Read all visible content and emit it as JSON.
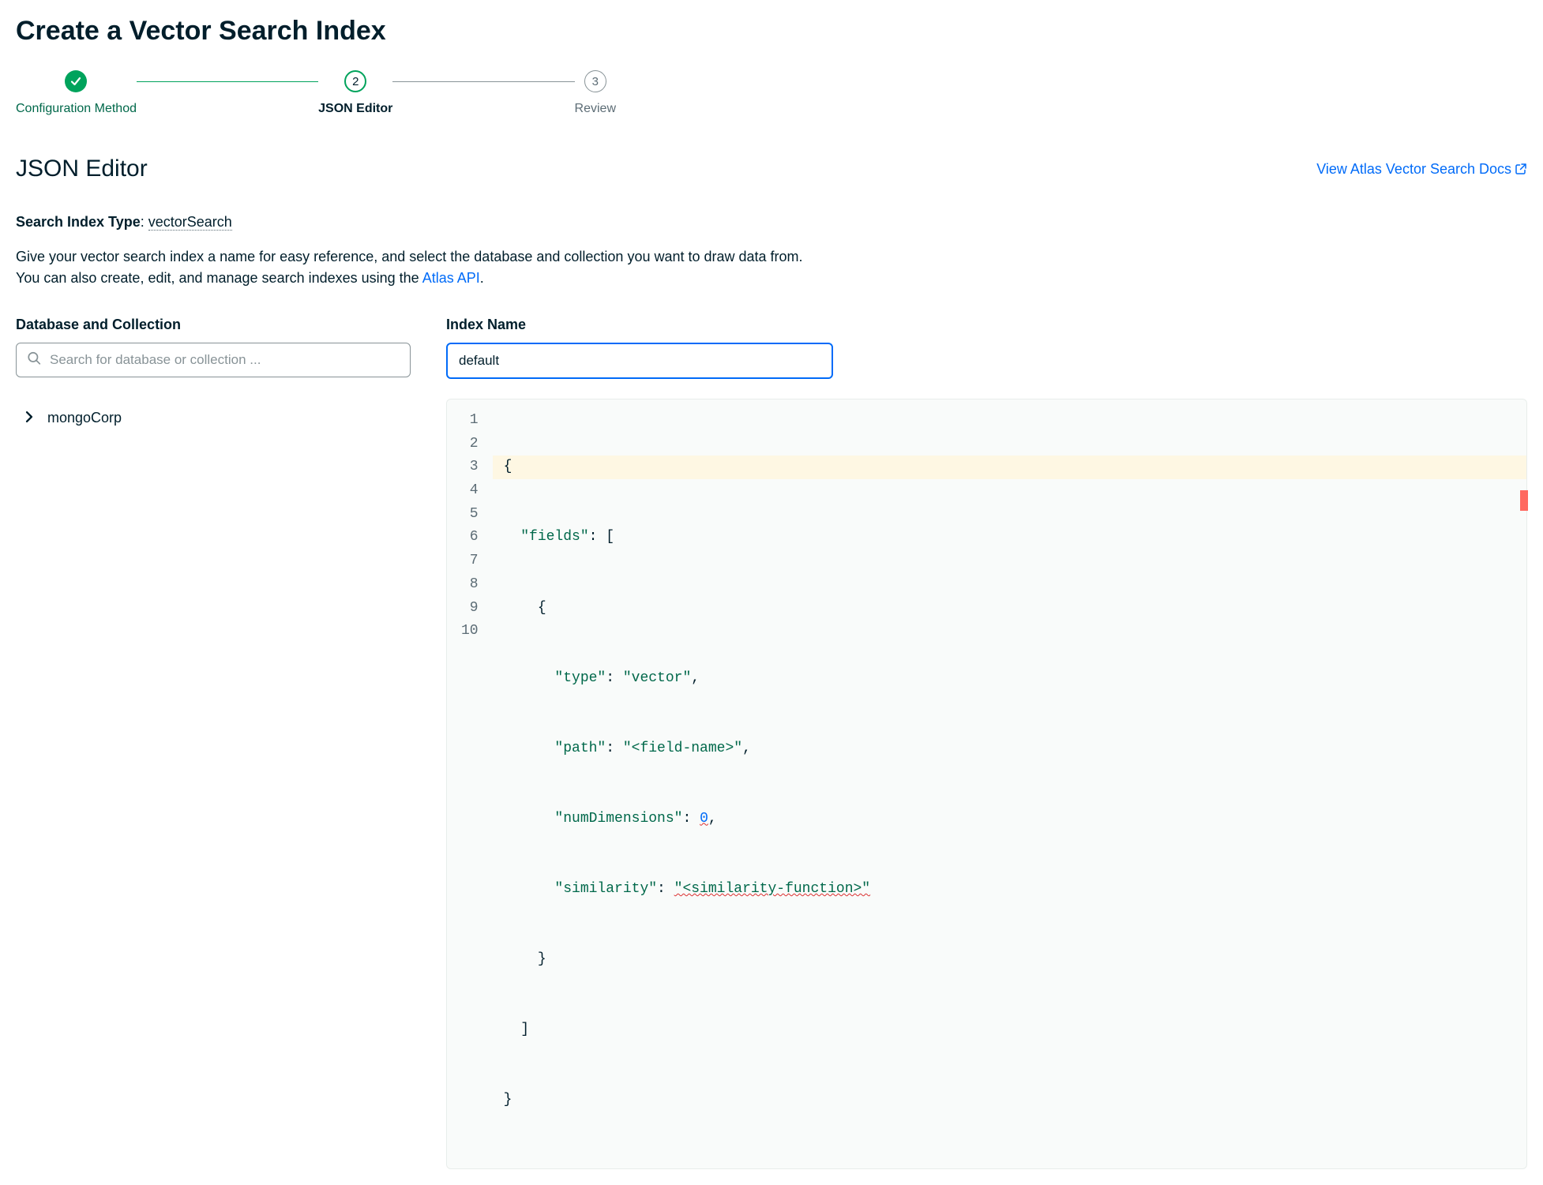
{
  "pageTitle": "Create a Vector Search Index",
  "stepper": {
    "steps": [
      {
        "label": "Configuration Method",
        "marker": "✓"
      },
      {
        "label": "JSON Editor",
        "marker": "2"
      },
      {
        "label": "Review",
        "marker": "3"
      }
    ]
  },
  "section": {
    "title": "JSON Editor",
    "docsLinkText": "View Atlas Vector Search Docs"
  },
  "indexType": {
    "label": "Search Index Type",
    "value": "vectorSearch"
  },
  "description": {
    "part1": "Give your vector search index a name for easy reference, and select the database and collection you want to draw data from. You can also create, edit, and manage search indexes using the ",
    "linkText": "Atlas API",
    "part2": "."
  },
  "dbCollection": {
    "label": "Database and Collection",
    "searchPlaceholder": "Search for database or collection ...",
    "treeItems": [
      {
        "name": "mongoCorp"
      }
    ]
  },
  "indexName": {
    "label": "Index Name",
    "value": "default"
  },
  "editor": {
    "lines": [
      {
        "n": "1",
        "raw": "{"
      },
      {
        "n": "2",
        "raw": "  \"fields\": ["
      },
      {
        "n": "3",
        "raw": "    {"
      },
      {
        "n": "4",
        "raw": "      \"type\": \"vector\","
      },
      {
        "n": "5",
        "raw": "      \"path\": \"<field-name>\","
      },
      {
        "n": "6",
        "raw": "      \"numDimensions\": 0,"
      },
      {
        "n": "7",
        "raw": "      \"similarity\": \"<similarity-function>\""
      },
      {
        "n": "8",
        "raw": "    }"
      },
      {
        "n": "9",
        "raw": "  ]"
      },
      {
        "n": "10",
        "raw": "}"
      }
    ],
    "tokens": {
      "fields": "\"fields\"",
      "type": "\"type\"",
      "vector": "\"vector\"",
      "path": "\"path\"",
      "fieldName": "\"<field-name>\"",
      "numDimensions": "\"numDimensions\"",
      "zero": "0",
      "similarity": "\"similarity\"",
      "simFunc": "\"<similarity-function>\""
    }
  }
}
